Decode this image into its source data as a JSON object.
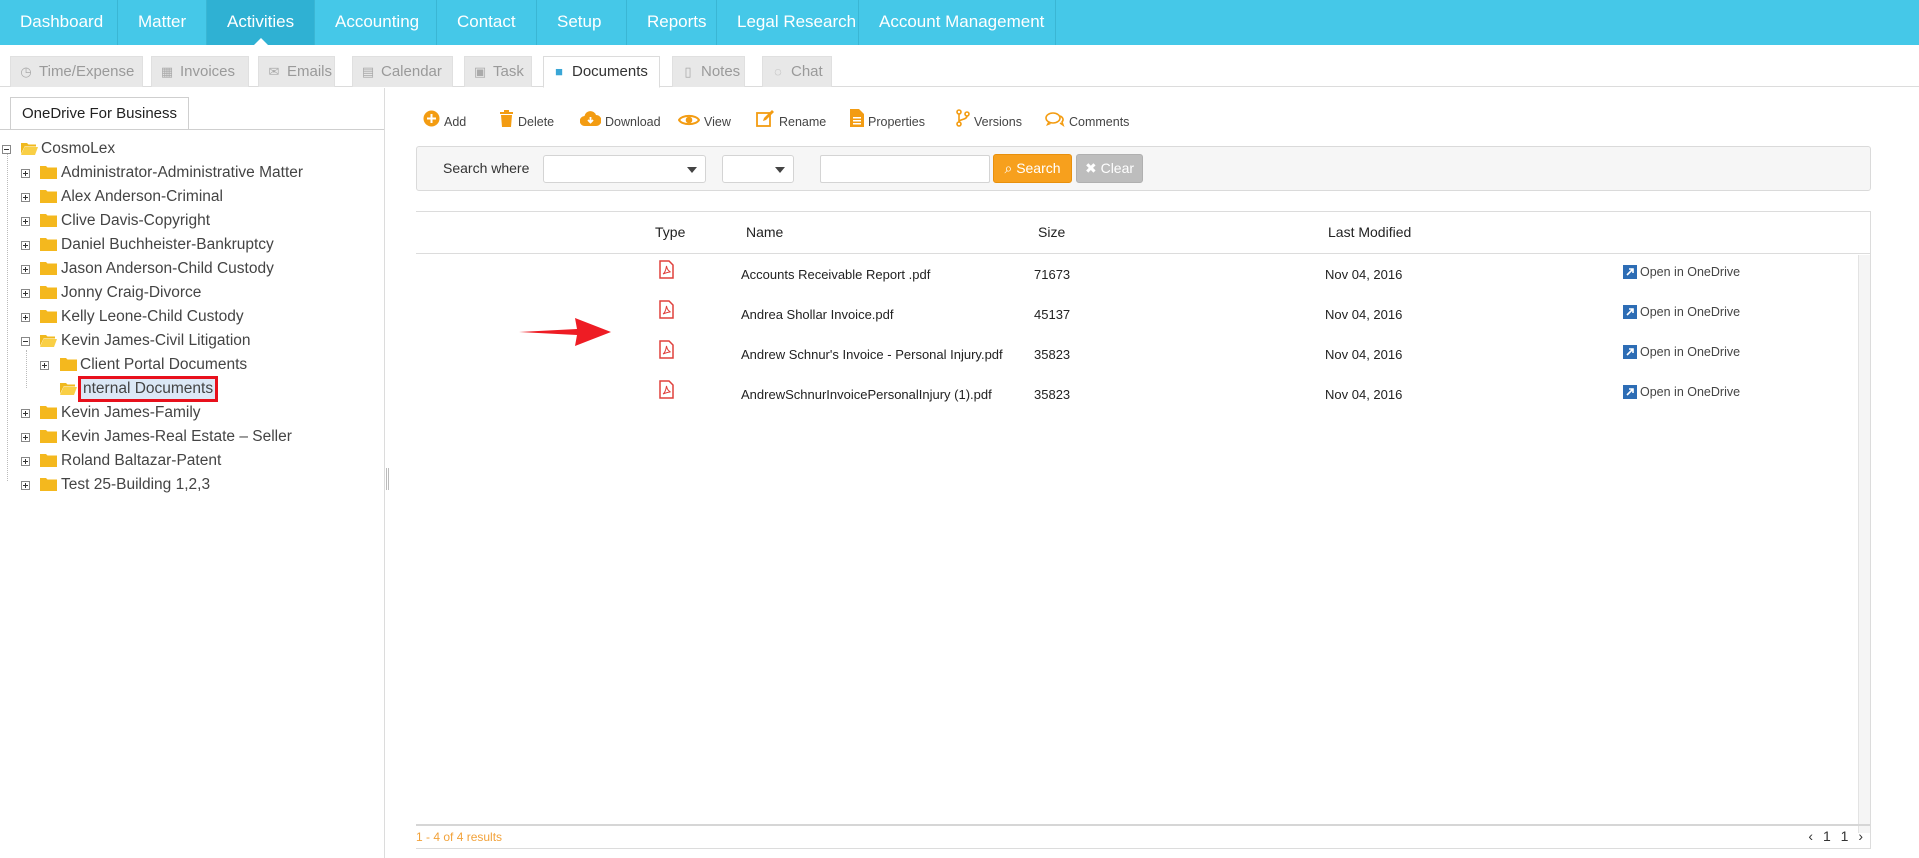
{
  "topnav": {
    "items": [
      {
        "label": "Dashboard"
      },
      {
        "label": "Matter"
      },
      {
        "label": "Activities",
        "active": true
      },
      {
        "label": "Accounting"
      },
      {
        "label": "Contact"
      },
      {
        "label": "Setup"
      },
      {
        "label": "Reports"
      },
      {
        "label": "Legal Research"
      },
      {
        "label": "Account Management"
      }
    ]
  },
  "subtabs": {
    "items": [
      {
        "label": "Time/Expense",
        "icon": "clock-icon"
      },
      {
        "label": "Invoices",
        "icon": "calculator-icon"
      },
      {
        "label": "Emails",
        "icon": "envelope-icon"
      },
      {
        "label": "Calendar",
        "icon": "calendar-icon"
      },
      {
        "label": "Task",
        "icon": "task-icon"
      },
      {
        "label": "Documents",
        "icon": "folder-icon",
        "active": true
      },
      {
        "label": "Notes",
        "icon": "note-icon"
      },
      {
        "label": "Chat",
        "icon": "chat-icon"
      }
    ]
  },
  "left_panel": {
    "tab_label": "OneDrive For Business",
    "tree": {
      "root": "CosmoLex",
      "nodes": [
        {
          "label": "Administrator-Administrative Matter"
        },
        {
          "label": "Alex Anderson-Criminal"
        },
        {
          "label": "Clive Davis-Copyright"
        },
        {
          "label": "Daniel Buchheister-Bankruptcy"
        },
        {
          "label": "Jason Anderson-Child Custody"
        },
        {
          "label": "Jonny Craig-Divorce"
        },
        {
          "label": "Kelly Leone-Child Custody"
        },
        {
          "label": "Kevin James-Civil Litigation",
          "expanded": true
        },
        {
          "label": "Client Portal Documents"
        },
        {
          "label": "nternal Documents",
          "selected": true
        },
        {
          "label": "Kevin James-Family"
        },
        {
          "label": "Kevin James-Real Estate – Seller"
        },
        {
          "label": "Roland Baltazar-Patent"
        },
        {
          "label": "Test 25-Building 1,2,3"
        }
      ]
    }
  },
  "toolbar": {
    "add": "Add",
    "delete": "Delete",
    "download": "Download",
    "view": "View",
    "rename": "Rename",
    "properties": "Properties",
    "versions": "Versions",
    "comments": "Comments"
  },
  "search": {
    "label": "Search where",
    "field_value": "",
    "operator_value": "",
    "query_value": "",
    "search_button": "Search",
    "clear_button": "Clear"
  },
  "grid": {
    "columns": {
      "type": "Type",
      "name": "Name",
      "size": "Size",
      "modified": "Last Modified"
    },
    "rows": [
      {
        "type": "pdf",
        "name": "Accounts Receivable Report .pdf",
        "size": "71673",
        "modified": "Nov 04, 2016",
        "action": "Open in OneDrive"
      },
      {
        "type": "pdf",
        "name": "Andrea Shollar Invoice.pdf",
        "size": "45137",
        "modified": "Nov 04, 2016",
        "action": "Open in OneDrive"
      },
      {
        "type": "pdf",
        "name": "Andrew Schnur's Invoice - Personal Injury.pdf",
        "size": "35823",
        "modified": "Nov 04, 2016",
        "action": "Open in OneDrive"
      },
      {
        "type": "pdf",
        "name": "AndrewSchnurInvoicePersonalInjury (1).pdf",
        "size": "35823",
        "modified": "Nov 04, 2016",
        "action": "Open in OneDrive"
      }
    ],
    "results_text": "1 - 4 of 4 results",
    "pager": {
      "prev": "‹",
      "page": "1",
      "total": "1",
      "next": "›"
    }
  },
  "colors": {
    "nav_bg": "#45c8e8",
    "accent_orange": "#f7a01d",
    "pdf_red": "#e0403c",
    "highlight_red": "#e8101c"
  }
}
